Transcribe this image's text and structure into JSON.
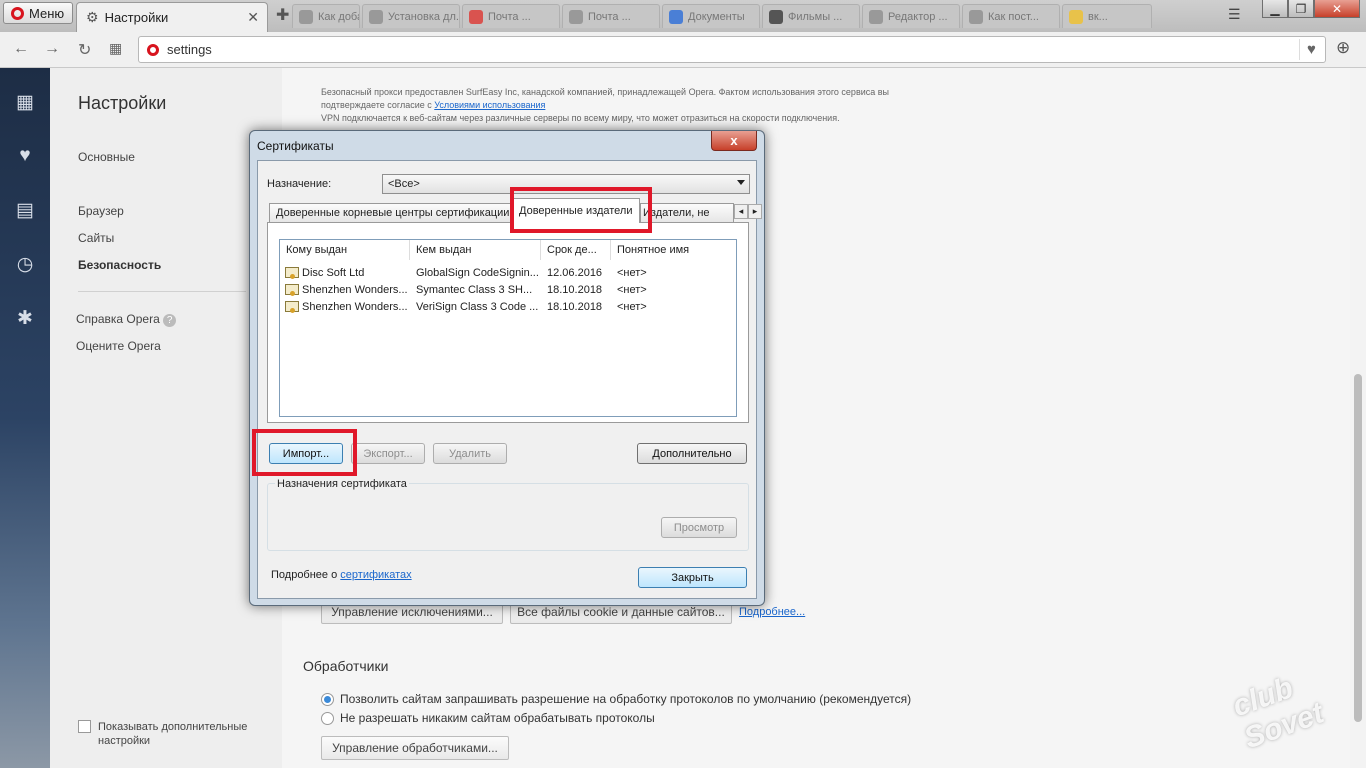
{
  "browser": {
    "menu_label": "Меню",
    "active_tab_title": "Настройки",
    "address": "settings",
    "background_tabs": [
      "Как добав...",
      "Установка дл...",
      "Почта ...",
      "Почта ...",
      "Документы",
      "Фильмы ...",
      "Редактор ...",
      "Как пост...",
      "вк..."
    ]
  },
  "settings": {
    "title": "Настройки",
    "nav": {
      "basic": "Основные",
      "browser": "Браузер",
      "sites": "Сайты",
      "security": "Безопасность",
      "help": "Справка Opera",
      "rate": "Оцените Opera"
    },
    "vpn_text_1": "Безопасный прокси предоставлен SurfEasy Inc, канадской компанией, принадлежащей Opera. Фактом использования этого сервиса вы",
    "vpn_text_2_prefix": "подтверждаете согласие с",
    "vpn_text_2_link": "Условиями использования",
    "vpn_text_3": "VPN подключается к веб-сайтам через различные серверы по всему миру, что может отразиться на скорости подключения.",
    "cookie_exceptions_button": "Управление исключениями...",
    "all_cookies_button": "Все файлы cookie и данные сайтов...",
    "more_link": "Подробнее...",
    "handlers_title": "Обработчики",
    "handlers_option_allow": "Позволить сайтам запрашивать разрешение на обработку протоколов по умолчанию (рекомендуется)",
    "handlers_option_deny": "Не разрешать никаким сайтам обрабатывать протоколы",
    "handlers_manage_button": "Управление обработчиками...",
    "show_advanced": "Показывать дополнительные настройки",
    "watermark": "club Sovet"
  },
  "dialog": {
    "title": "Сертификаты",
    "close_glyph": "x",
    "purpose_label": "Назначение:",
    "purpose_value": "<Все>",
    "tabs": {
      "root": "Доверенные корневые центры сертификации",
      "publishers": "Доверенные издатели",
      "untrusted": "Издатели, не"
    },
    "columns": [
      "Кому выдан",
      "Кем выдан",
      "Срок де...",
      "Понятное имя"
    ],
    "rows": [
      [
        "Disc Soft Ltd",
        "GlobalSign CodeSignin...",
        "12.06.2016",
        "<нет>"
      ],
      [
        "Shenzhen Wonders...",
        "Symantec Class 3 SH...",
        "18.10.2018",
        "<нет>"
      ],
      [
        "Shenzhen Wonders...",
        "VeriSign Class 3 Code ...",
        "18.10.2018",
        "<нет>"
      ]
    ],
    "buttons": {
      "import": "Импорт...",
      "export": "Экспорт...",
      "delete": "Удалить",
      "advanced": "Дополнительно",
      "view": "Просмотр",
      "close": "Закрыть"
    },
    "cert_purposes_label": "Назначения сертификата",
    "more_info_prefix": "Подробнее о",
    "more_info_link": "сертификатах"
  },
  "colors": {
    "highlight": "#e0182a",
    "opera_red": "#d8141e",
    "link": "#1a66cc"
  }
}
